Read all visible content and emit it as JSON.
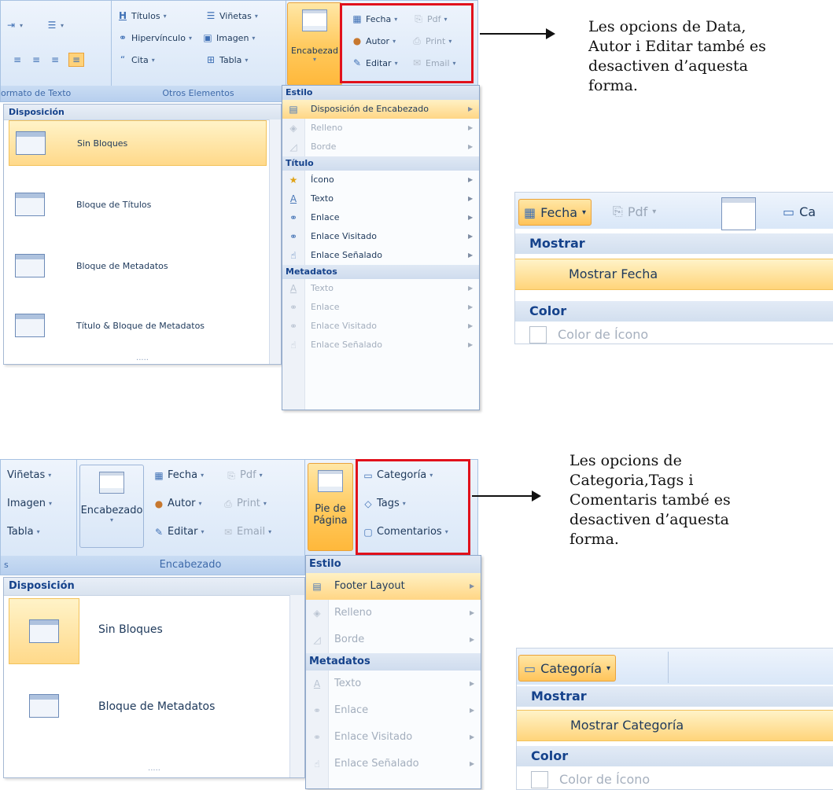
{
  "top": {
    "ribbon": {
      "format_group_label": "ormato de Texto",
      "other_group_label": "Otros Elementos",
      "titulos": "Títulos",
      "vinetas": "Viñetas",
      "hipervinculo": "Hipervínculo",
      "imagen": "Imagen",
      "cita": "Cita",
      "tabla": "Tabla",
      "encabezado": "Encabezad",
      "fecha": "Fecha",
      "pdf": "Pdf",
      "autor": "Autor",
      "print": "Print",
      "editar": "Editar",
      "email": "Email"
    },
    "layout_panel": {
      "header": "Disposición",
      "items": [
        "Sin Bloques",
        "Bloque de Títulos",
        "Bloque de Metadatos",
        "Título & Bloque de Metadatos"
      ],
      "footer_dots": "....."
    },
    "menu": {
      "estilo": "Estilo",
      "disposicion": "Disposición de Encabezado",
      "relleno": "Relleno",
      "borde": "Borde",
      "titulo": "Título",
      "icono": "Ícono",
      "texto": "Texto",
      "enlace": "Enlace",
      "enlace_visitado": "Enlace Visitado",
      "enlace_senalado": "Enlace Señalado",
      "metadatos": "Metadatos",
      "m_texto": "Texto",
      "m_enlace": "Enlace",
      "m_enlace_visitado": "Enlace Visitado",
      "m_enlace_senalado": "Enlace Señalado"
    },
    "note": "Les opcions de Data, Autor i Editar també es desactiven d’aquesta forma.",
    "zoom": {
      "fecha": "Fecha",
      "pdf": "Pdf",
      "ca": "Ca",
      "mostrar": "Mostrar",
      "mostrar_item": "Mostrar Fecha",
      "color": "Color",
      "color_icono": "Color de Ícono"
    }
  },
  "bottom": {
    "ribbon": {
      "vinetas": "Viñetas",
      "imagen": "Imagen",
      "tabla": "Tabla",
      "s_label": "s",
      "encabezado": "Encabezado",
      "encabezado_group": "Encabezado",
      "fecha": "Fecha",
      "pdf": "Pdf",
      "autor": "Autor",
      "print": "Print",
      "editar": "Editar",
      "email": "Email",
      "pie_de": "Pie de",
      "pagina": "Página",
      "categoria": "Categoría",
      "tags": "Tags",
      "comentarios": "Comentarios"
    },
    "layout_panel": {
      "header": "Disposición",
      "items": [
        "Sin Bloques",
        "Bloque de Metadatos"
      ],
      "footer_dots": "....."
    },
    "menu": {
      "estilo": "Estilo",
      "footer_layout": "Footer Layout",
      "relleno": "Relleno",
      "borde": "Borde",
      "metadatos": "Metadatos",
      "texto": "Texto",
      "enlace": "Enlace",
      "enlace_visitado": "Enlace Visitado",
      "enlace_senalado": "Enlace Señalado"
    },
    "note": "Les opcions de Categoria,Tags i Comentaris també es desactiven d’aquesta forma.",
    "zoom": {
      "categoria": "Categoría",
      "mostrar": "Mostrar",
      "mostrar_item": "Mostrar Categoría",
      "color": "Color",
      "color_icono": "Color de Ícono"
    }
  },
  "colors": {
    "highlight_box": "#e1111b",
    "selection": "#ffd98a",
    "ribbon_text": "#15428b"
  }
}
